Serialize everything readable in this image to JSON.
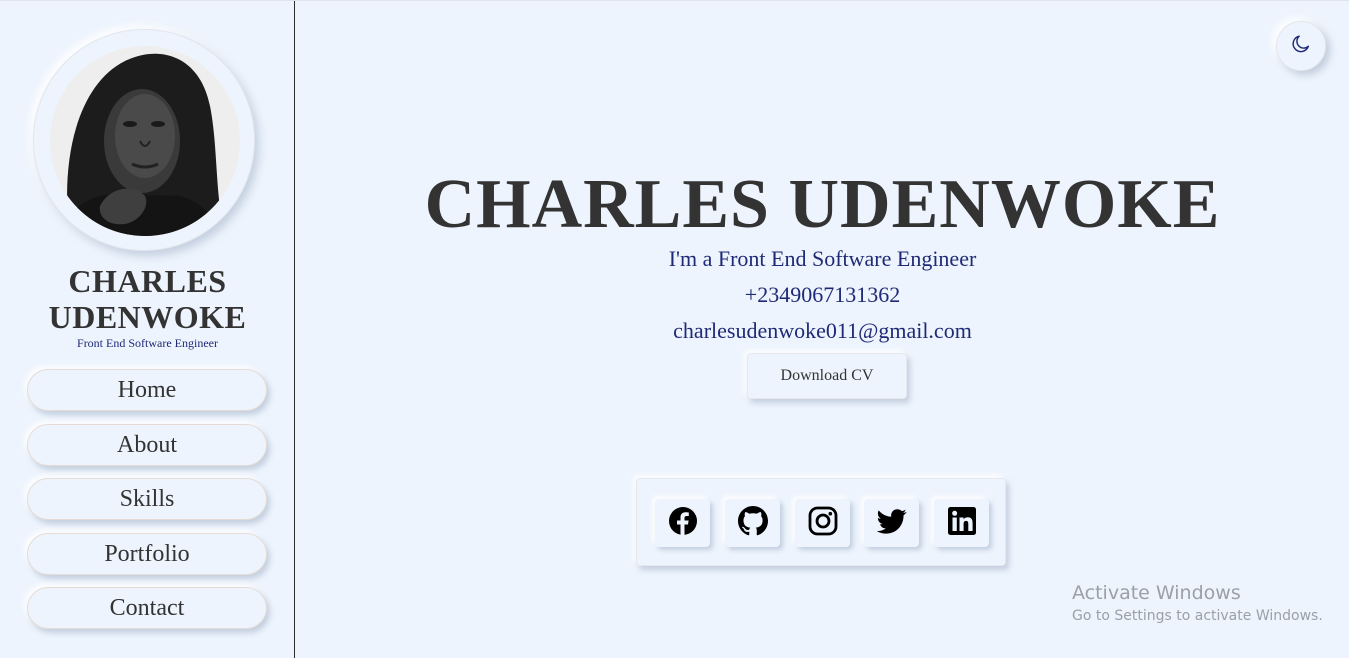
{
  "sidebar": {
    "name_line1": "CHARLES",
    "name_line2": "UDENWOKE",
    "role": "Front End Software Engineer",
    "nav": [
      "Home",
      "About",
      "Skills",
      "Portfolio",
      "Contact"
    ]
  },
  "main": {
    "name": "CHARLES UDENWOKE",
    "role": "I'm a Front End Software Engineer",
    "phone": "+2349067131362",
    "email": "charlesudenwoke011@gmail.com",
    "cv_button": "Download CV",
    "theme_toggle_icon": "moon-icon",
    "social_icons": [
      "facebook-icon",
      "github-icon",
      "instagram-icon",
      "twitter-icon",
      "linkedin-icon"
    ]
  },
  "watermark": {
    "title": "Activate Windows",
    "subtitle": "Go to Settings to activate Windows."
  },
  "colors": {
    "background": "#edf4fd",
    "heading": "#333333",
    "accent_text": "#1f2a77",
    "moon_icon": "#1f2a77"
  }
}
